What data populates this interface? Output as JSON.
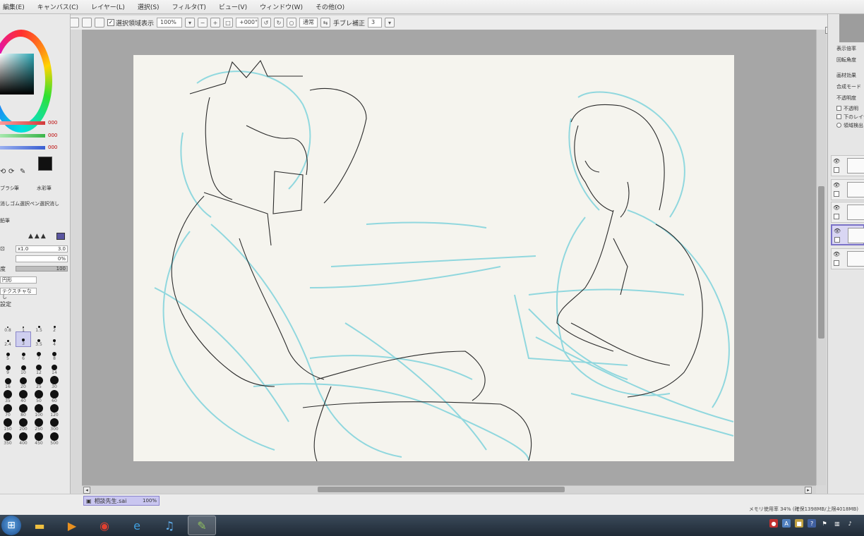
{
  "menu": [
    "編集(E)",
    "キャンバス(C)",
    "レイヤー(L)",
    "選択(S)",
    "フィルタ(T)",
    "ビュー(V)",
    "ウィンドウ(W)",
    "その他(O)"
  ],
  "toolbar": {
    "show_selection_label": "選択領域表示",
    "zoom": "100%",
    "rotation": "+000°",
    "blend_mode": "通常",
    "stabilizer_label": "手ブレ補正",
    "stabilizer_value": "3"
  },
  "left_panel": {
    "sliders": [
      {
        "color": "#d23a3a",
        "value": "000"
      },
      {
        "color": "#3ab54a",
        "value": "000"
      },
      {
        "color": "#3a5fd2",
        "value": "000"
      }
    ],
    "tools": [
      "ブラシ",
      "筆",
      "水彩筆",
      "消しゴム",
      "選択ペン",
      "選択消し",
      "鉛筆"
    ],
    "size_label": "x1.0",
    "size_value": "3.0",
    "min_size_value": "0%",
    "density_label": "度",
    "density_value": "100",
    "shape_dd": "円形",
    "texture_dd": "テクスチャなし",
    "brush_settings_label": "設定",
    "brush_sizes": [
      "0.8",
      "1",
      "1.5",
      "2",
      "2.4",
      "3",
      "3.5",
      "4",
      "5",
      "6",
      "7",
      "8",
      "9",
      "10",
      "12",
      "14",
      "16",
      "20",
      "25",
      "30",
      "35",
      "40",
      "50",
      "60",
      "70",
      "80",
      "100",
      "120",
      "150",
      "200",
      "250",
      "300",
      "350",
      "400",
      "450",
      "500"
    ]
  },
  "right_panel": {
    "nav_labels": [
      "表示倍率",
      "回転角度"
    ],
    "layer_props": [
      "画材効果",
      "合成モード",
      "不透明度"
    ],
    "layer_checks": [
      "不透明",
      "下のレイヤ",
      "領域検出"
    ]
  },
  "status": {
    "file_name": "相談先生.sai",
    "file_zoom": "100%",
    "memory": "メモリ使用率 34% (確保1398MB/上限4018MB)"
  },
  "taskbar": {
    "apps": [
      "explorer-icon",
      "media-player-icon",
      "chrome-icon",
      "internet-explorer-icon",
      "itunes-icon",
      "paint-tool-sai-icon"
    ]
  }
}
